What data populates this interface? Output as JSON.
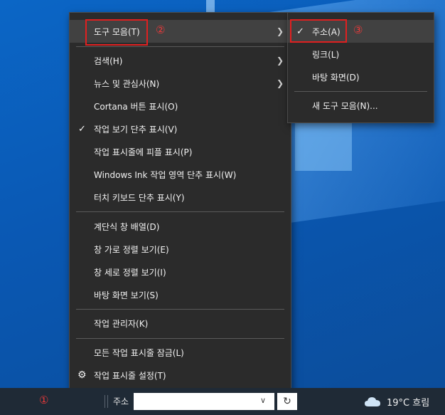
{
  "main_menu": {
    "items": [
      {
        "label": "도구 모음(T)",
        "has_submenu": true,
        "checked": false
      },
      {
        "label": "검색(H)",
        "has_submenu": true,
        "checked": false
      },
      {
        "label": "뉴스 및 관심사(N)",
        "has_submenu": true,
        "checked": false
      },
      {
        "label": "Cortana 버튼 표시(O)",
        "has_submenu": false,
        "checked": false
      },
      {
        "label": "작업 보기 단추 표시(V)",
        "has_submenu": false,
        "checked": true
      },
      {
        "label": "작업 표시줄에 피플 표시(P)",
        "has_submenu": false,
        "checked": false
      },
      {
        "label": "Windows Ink 작업 영역 단추 표시(W)",
        "has_submenu": false,
        "checked": false
      },
      {
        "label": "터치 키보드 단추 표시(Y)",
        "has_submenu": false,
        "checked": false
      },
      {
        "label": "계단식 창 배열(D)",
        "has_submenu": false,
        "checked": false
      },
      {
        "label": "창 가로 정렬 보기(E)",
        "has_submenu": false,
        "checked": false
      },
      {
        "label": "창 세로 정렬 보기(I)",
        "has_submenu": false,
        "checked": false
      },
      {
        "label": "바탕 화면 보기(S)",
        "has_submenu": false,
        "checked": false
      },
      {
        "label": "작업 관리자(K)",
        "has_submenu": false,
        "checked": false
      },
      {
        "label": "모든 작업 표시줄 잠금(L)",
        "has_submenu": false,
        "checked": false
      },
      {
        "label": "작업 표시줄 설정(T)",
        "has_submenu": false,
        "checked": false,
        "icon": "gear-icon"
      }
    ]
  },
  "toolbars_submenu": {
    "items": [
      {
        "label": "주소(A)",
        "checked": true
      },
      {
        "label": "링크(L)",
        "checked": false
      },
      {
        "label": "바탕 화면(D)",
        "checked": false
      },
      {
        "label": "새 도구 모음(N)...",
        "checked": false
      }
    ]
  },
  "annotations": {
    "badge1": "①",
    "badge2": "②",
    "badge3": "③",
    "color": "#e02020"
  },
  "taskbar": {
    "address_label": "주소",
    "address_value": "",
    "weather": "19°C 흐림"
  },
  "icons": {
    "submenu_arrow": "chevron-right-icon",
    "check": "check-icon",
    "settings": "gear-icon",
    "refresh": "refresh-icon",
    "weather": "cloud-icon"
  }
}
